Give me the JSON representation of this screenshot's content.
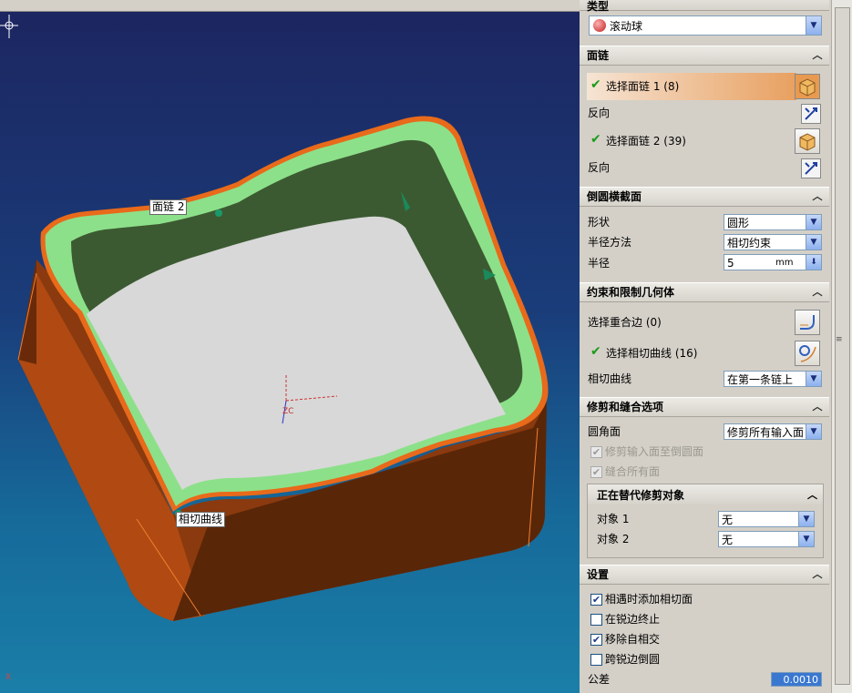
{
  "viewport": {
    "callouts": {
      "face_chain_2": "面链 2",
      "tangent_curve": "相切曲线"
    },
    "axis_labels": {
      "zc": "ZC",
      "x_mark": "X"
    }
  },
  "panel": {
    "type_section": {
      "label": "类型",
      "value": "滚动球"
    },
    "face_chain": {
      "title": "面链",
      "select1": "选择面链 1 (8)",
      "reverse1": "反向",
      "select2": "选择面链 2 (39)",
      "reverse2": "反向"
    },
    "cross_section": {
      "title": "倒圆横截面",
      "shape_label": "形状",
      "shape_value": "圆形",
      "radius_method_label": "半径方法",
      "radius_method_value": "相切约束",
      "radius_label": "半径",
      "radius_value": "5",
      "radius_unit": "mm"
    },
    "constraints": {
      "title": "约束和限制几何体",
      "coincident": "选择重合边 (0)",
      "tangent": "选择相切曲线 (16)",
      "tangent_curve_label": "相切曲线",
      "tangent_curve_value": "在第一条链上"
    },
    "trim": {
      "title": "修剪和缝合选项",
      "fillet_face_label": "圆角面",
      "fillet_face_value": "修剪所有输入面",
      "trim_input": "修剪输入面至倒圆面",
      "stitch_all": "缝合所有面",
      "sub_title": "正在替代修剪对象",
      "obj1_label": "对象 1",
      "obj1_value": "无",
      "obj2_label": "对象 2",
      "obj2_value": "无"
    },
    "settings": {
      "title": "设置",
      "add_tangent": "相遇时添加相切面",
      "stop_sharp": "在锐边终止",
      "remove_self": "移除自相交",
      "across_sharp": "跨锐边倒圆",
      "tolerance_label": "公差",
      "tolerance_value": "0.0010"
    }
  },
  "colors": {
    "accent_orange": "#e88c3c",
    "check_green": "#1a9a1a",
    "model_green": "#8de08a",
    "model_orange": "#d0641a"
  }
}
